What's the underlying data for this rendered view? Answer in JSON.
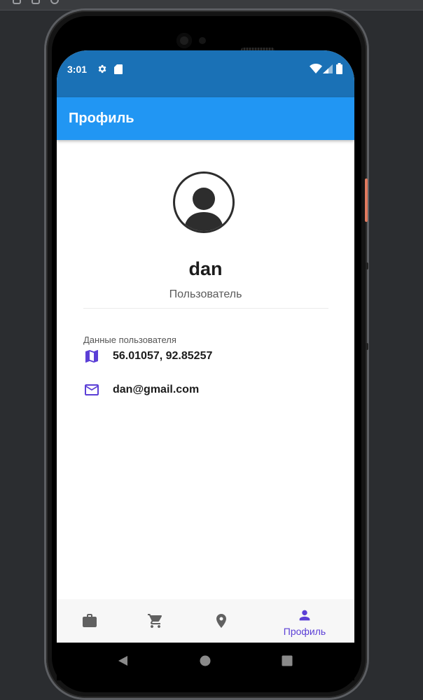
{
  "status_bar": {
    "time": "3:01",
    "icons": [
      "gear-icon",
      "sd-card-icon",
      "wifi-icon",
      "signal-icon",
      "battery-icon"
    ]
  },
  "app_bar": {
    "title": "Профиль"
  },
  "profile": {
    "name": "dan",
    "role": "Пользователь",
    "avatar_icon": "account-circle-icon"
  },
  "user_data": {
    "section_label": "Данные пользователя",
    "location": {
      "icon": "map-icon",
      "value": "56.01057, 92.85257"
    },
    "email": {
      "icon": "email-icon",
      "value": "dan@gmail.com"
    }
  },
  "bottom_nav": {
    "items": [
      {
        "icon": "briefcase-icon",
        "label": ""
      },
      {
        "icon": "cart-icon",
        "label": ""
      },
      {
        "icon": "location-pin-icon",
        "label": ""
      },
      {
        "icon": "person-icon",
        "label": "Профиль",
        "active": true
      }
    ]
  },
  "system_nav": [
    "back-icon",
    "home-icon",
    "recents-icon"
  ],
  "colors": {
    "status_bar": "#1a71b6",
    "app_bar": "#2196f3",
    "accent": "#5b3fd6",
    "icon_grey": "#616161"
  }
}
